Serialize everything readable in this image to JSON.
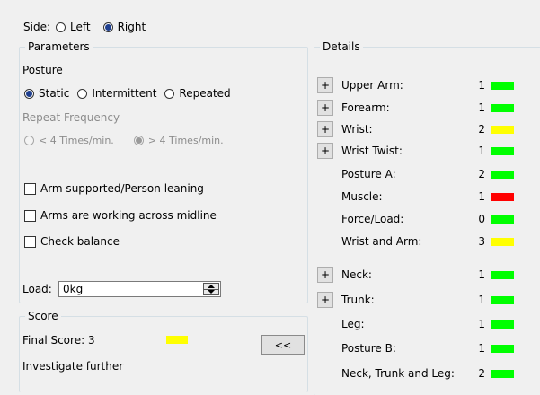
{
  "side": {
    "label": "Side:",
    "options": [
      {
        "label": "Left",
        "checked": false
      },
      {
        "label": "Right",
        "checked": true
      }
    ]
  },
  "parameters": {
    "title": "Parameters",
    "posture": {
      "label": "Posture",
      "options": [
        {
          "label": "Static",
          "checked": true
        },
        {
          "label": "Intermittent",
          "checked": false
        },
        {
          "label": "Repeated",
          "checked": false
        }
      ]
    },
    "repeat_frequency": {
      "label": "Repeat Frequency",
      "enabled": false,
      "options": [
        {
          "label": "< 4 Times/min.",
          "checked": false
        },
        {
          "label": "> 4 Times/min.",
          "checked": true
        }
      ]
    },
    "checkboxes": [
      {
        "label": "Arm supported/Person leaning",
        "checked": false
      },
      {
        "label": "Arms are working across midline",
        "checked": false
      },
      {
        "label": "Check balance",
        "checked": false
      }
    ],
    "load": {
      "label": "Load:",
      "value": "0kg"
    }
  },
  "score": {
    "title": "Score",
    "final_label": "Final Score: 3",
    "final_color": "#ffff00",
    "message": "Investigate further",
    "collapse_button": "<<"
  },
  "details": {
    "title": "Details",
    "expand_label": "+",
    "rows": [
      {
        "label": "Upper Arm:",
        "value": "1",
        "color": "#00ff00",
        "expandable": true
      },
      {
        "label": "Forearm:",
        "value": "1",
        "color": "#00ff00",
        "expandable": true
      },
      {
        "label": "Wrist:",
        "value": "2",
        "color": "#ffff00",
        "expandable": true
      },
      {
        "label": "Wrist Twist:",
        "value": "1",
        "color": "#00ff00",
        "expandable": true
      },
      {
        "label": "Posture A:",
        "value": "2",
        "color": "#00ff00",
        "expandable": false
      },
      {
        "label": "Muscle:",
        "value": "1",
        "color": "#ff0000",
        "expandable": false
      },
      {
        "label": "Force/Load:",
        "value": "0",
        "color": "#00ff00",
        "expandable": false
      },
      {
        "label": "Wrist and Arm:",
        "value": "3",
        "color": "#ffff00",
        "expandable": false
      },
      {
        "label": "Neck:",
        "value": "1",
        "color": "#00ff00",
        "expandable": true
      },
      {
        "label": "Trunk:",
        "value": "1",
        "color": "#00ff00",
        "expandable": true
      },
      {
        "label": "Leg:",
        "value": "1",
        "color": "#00ff00",
        "expandable": false
      },
      {
        "label": "Posture B:",
        "value": "1",
        "color": "#00ff00",
        "expandable": false
      },
      {
        "label": "Neck, Trunk and Leg:",
        "value": "2",
        "color": "#00ff00",
        "expandable": false
      }
    ]
  }
}
